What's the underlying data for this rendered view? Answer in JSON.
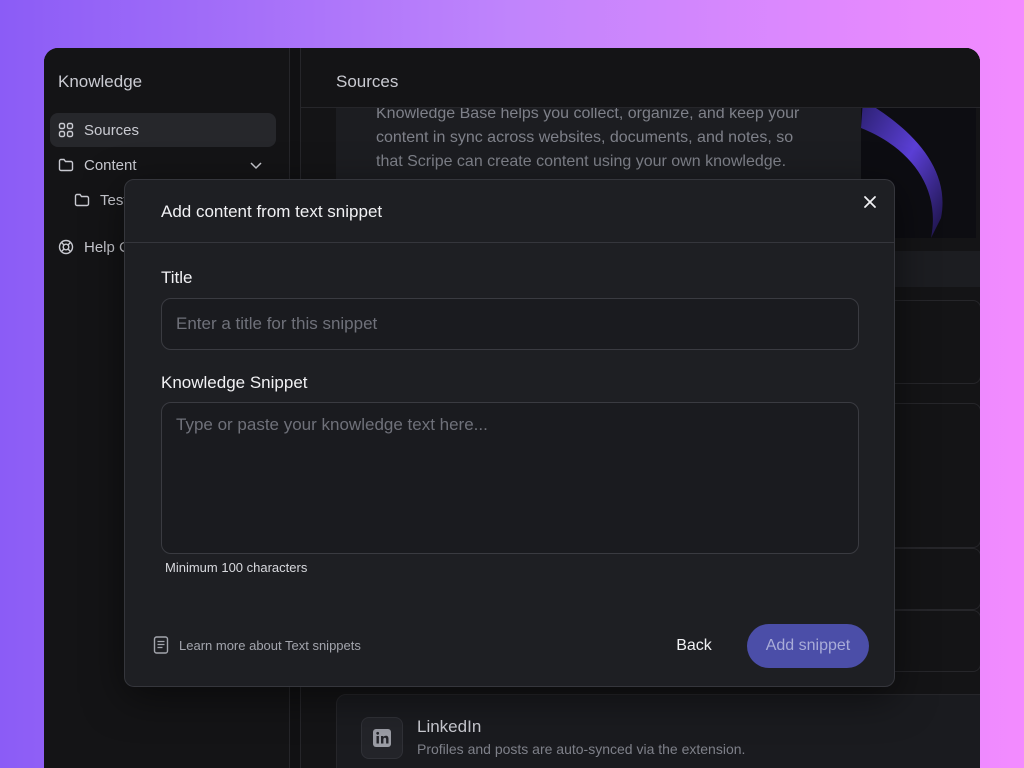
{
  "sidebar": {
    "title": "Knowledge",
    "items": [
      {
        "label": "Sources",
        "icon": "grid-icon",
        "active": true
      },
      {
        "label": "Content",
        "icon": "folder-icon",
        "expandable": true
      },
      {
        "label": "Test",
        "icon": "folder-icon"
      },
      {
        "label": "Help C",
        "icon": "lifebuoy-icon"
      }
    ]
  },
  "main": {
    "header_title": "Sources",
    "intro_text": "Knowledge Base helps you collect, organize, and keep your content in sync across websites, documents, and notes, so that Scripe can create content using your own knowledge.",
    "linkedin": {
      "title": "LinkedIn",
      "description": "Profiles and posts are auto-synced via the extension.",
      "icon": "linkedin-icon"
    }
  },
  "modal": {
    "title": "Add content from text snippet",
    "title_field": {
      "label": "Title",
      "placeholder": "Enter a title for this snippet",
      "value": ""
    },
    "snippet_field": {
      "label": "Knowledge Snippet",
      "placeholder": "Type or paste your knowledge text here...",
      "value": "",
      "hint": "Minimum 100 characters"
    },
    "learn_more": "Learn more about Text snippets",
    "back_label": "Back",
    "submit_label": "Add snippet"
  },
  "colors": {
    "accent": "#4b4ea8",
    "background_gradient_start": "#8b5cf6",
    "background_gradient_end": "#f38bff"
  }
}
